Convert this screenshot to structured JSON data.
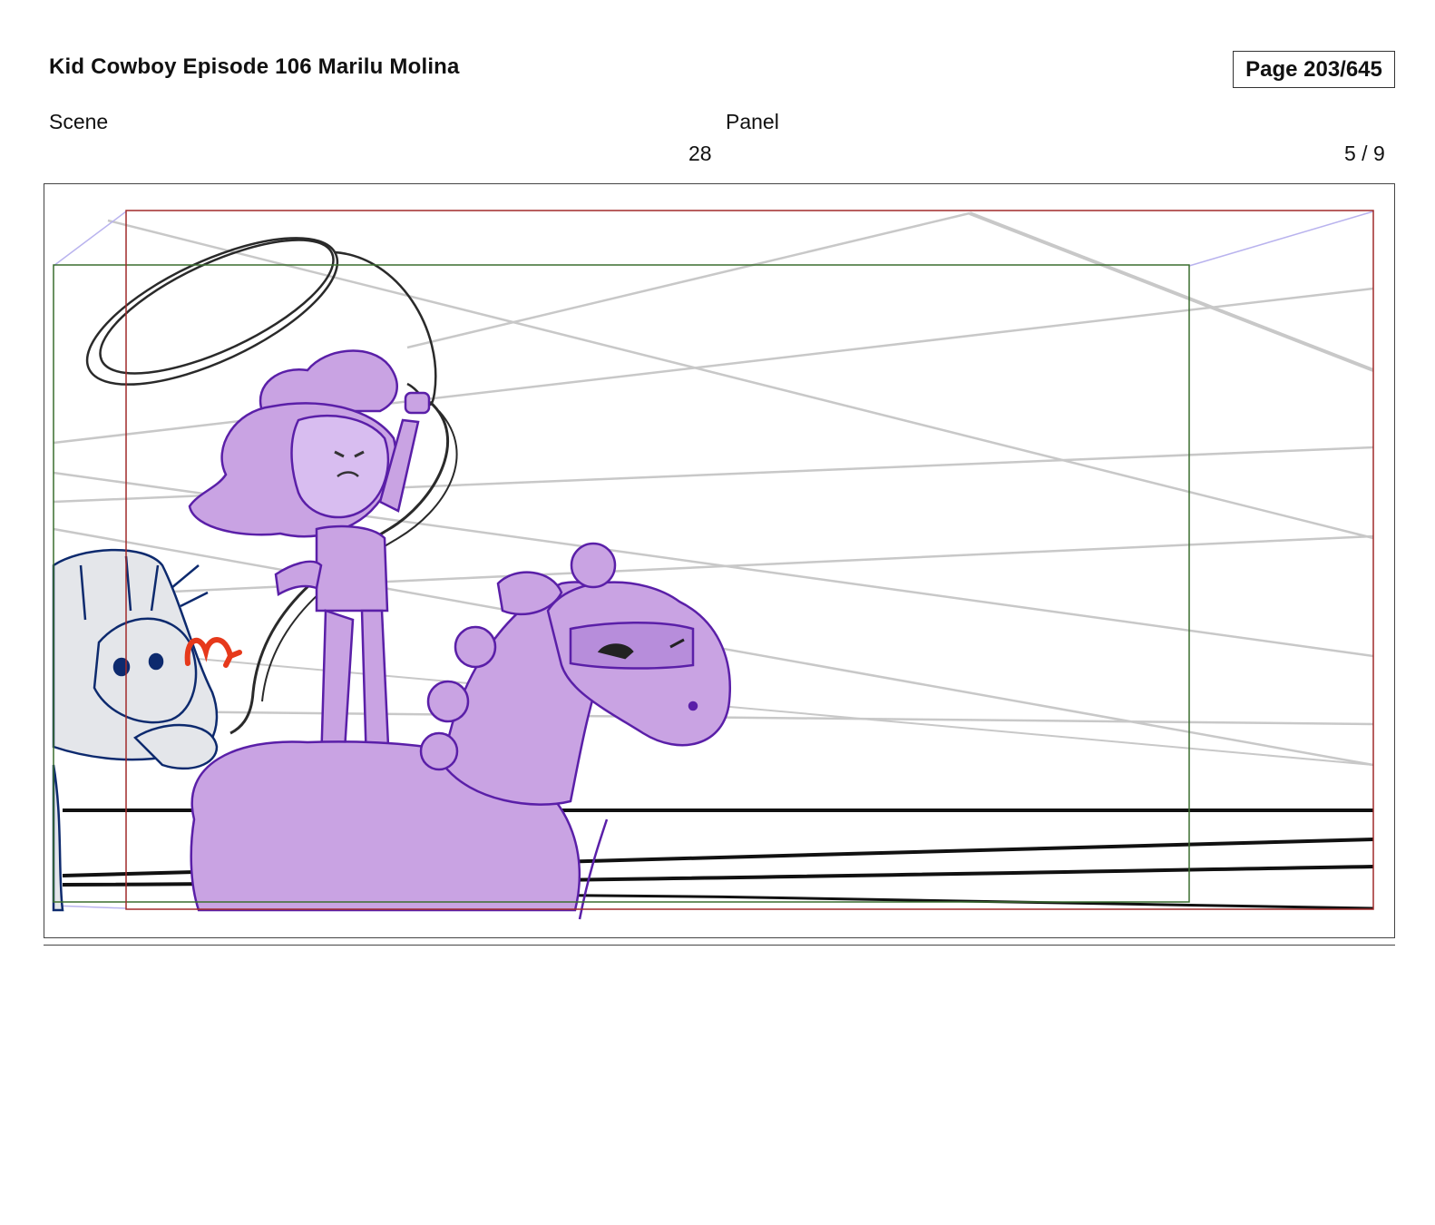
{
  "header": {
    "title": "Kid Cowboy Episode 106 Marilu Molina",
    "page_label": "Page 203/645"
  },
  "meta": {
    "scene_label": "Scene",
    "scene_value": "28",
    "panel_label": "Panel",
    "panel_value": "5 / 9"
  },
  "artwork": {
    "description_icon": "storyboard-sketch",
    "colors": {
      "character_fill": "#c9a3e3",
      "character_line": "#5a1fa8",
      "horse_line": "#0d2a6e",
      "horse_fill": "#e4e6ea",
      "guide_red": "#a12a2a",
      "guide_green": "#3a6e2f",
      "perspective_lines": "#c8c8c8",
      "lasso_line": "#2a2a2a",
      "arrow_red": "#e6391b"
    }
  }
}
